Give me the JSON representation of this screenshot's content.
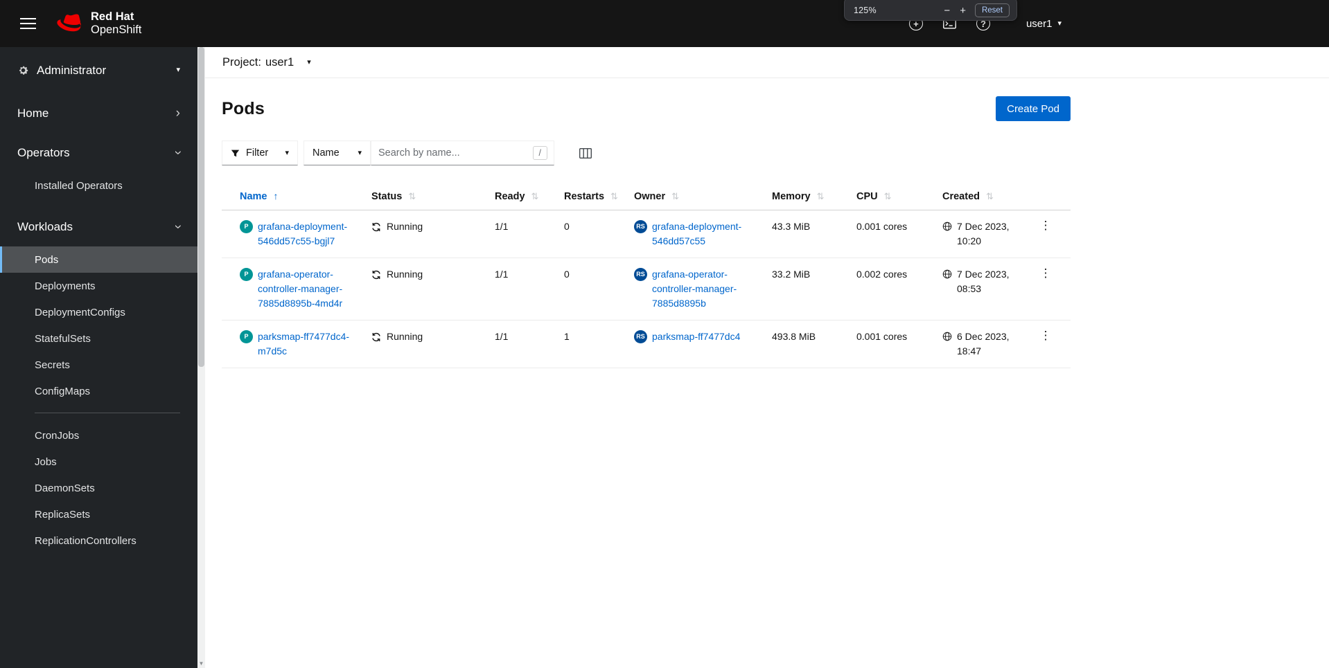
{
  "colors": {
    "primary": "#0066cc",
    "link": "#0066cc",
    "pod_badge": "#009596",
    "replicaset_badge": "#004b95",
    "masthead_bg": "#151515",
    "sidebar_bg": "#212427",
    "selected_nav_bg": "#4f5255"
  },
  "masthead": {
    "brand_line1": "Red Hat",
    "brand_line2": "OpenShift",
    "user": "user1",
    "zoom_popup": {
      "level": "125%",
      "minus": "−",
      "plus": "+",
      "reset": "Reset"
    }
  },
  "icons": {
    "caret_down": "▾",
    "chevron_right": "›",
    "sort_active": "↑",
    "sort_inactive": "⇅",
    "kebab": "⋮",
    "help_glyph": "?",
    "plus_glyph": "+",
    "search_shortcut": "/",
    "scroll_arrow": "▼"
  },
  "sidebar": {
    "perspective": "Administrator",
    "home": "Home",
    "operators": "Operators",
    "operators_children": [
      "Installed Operators"
    ],
    "workloads": "Workloads",
    "workloads_children": [
      "Pods",
      "Deployments",
      "DeploymentConfigs",
      "StatefulSets",
      "Secrets",
      "ConfigMaps",
      "CronJobs",
      "Jobs",
      "DaemonSets",
      "ReplicaSets",
      "ReplicationControllers"
    ],
    "selected_item": "Pods"
  },
  "project_bar": {
    "label": "Project:",
    "value": "user1"
  },
  "page": {
    "title": "Pods",
    "create_button": "Create Pod"
  },
  "toolbar": {
    "filter_label": "Filter",
    "attribute_label": "Name",
    "search_placeholder": "Search by name..."
  },
  "table": {
    "columns": [
      "Name",
      "Status",
      "Ready",
      "Restarts",
      "Owner",
      "Memory",
      "CPU",
      "Created"
    ],
    "sorted_column": "Name",
    "sort_direction": "asc",
    "rows": [
      {
        "name_badge": "P",
        "name": "grafana-deployment-546dd57c55-bgjl7",
        "status": "Running",
        "ready": "1/1",
        "restarts": "0",
        "owner_badge": "RS",
        "owner": "grafana-deployment-546dd57c55",
        "memory": "43.3 MiB",
        "cpu": "0.001 cores",
        "created": "7 Dec 2023, 10:20"
      },
      {
        "name_badge": "P",
        "name": "grafana-operator-controller-manager-7885d8895b-4md4r",
        "status": "Running",
        "ready": "1/1",
        "restarts": "0",
        "owner_badge": "RS",
        "owner": "grafana-operator-controller-manager-7885d8895b",
        "memory": "33.2 MiB",
        "cpu": "0.002 cores",
        "created": "7 Dec 2023, 08:53"
      },
      {
        "name_badge": "P",
        "name": "parksmap-ff7477dc4-m7d5c",
        "status": "Running",
        "ready": "1/1",
        "restarts": "1",
        "owner_badge": "RS",
        "owner": "parksmap-ff7477dc4",
        "memory": "493.8 MiB",
        "cpu": "0.001 cores",
        "created": "6 Dec 2023, 18:47"
      }
    ]
  }
}
